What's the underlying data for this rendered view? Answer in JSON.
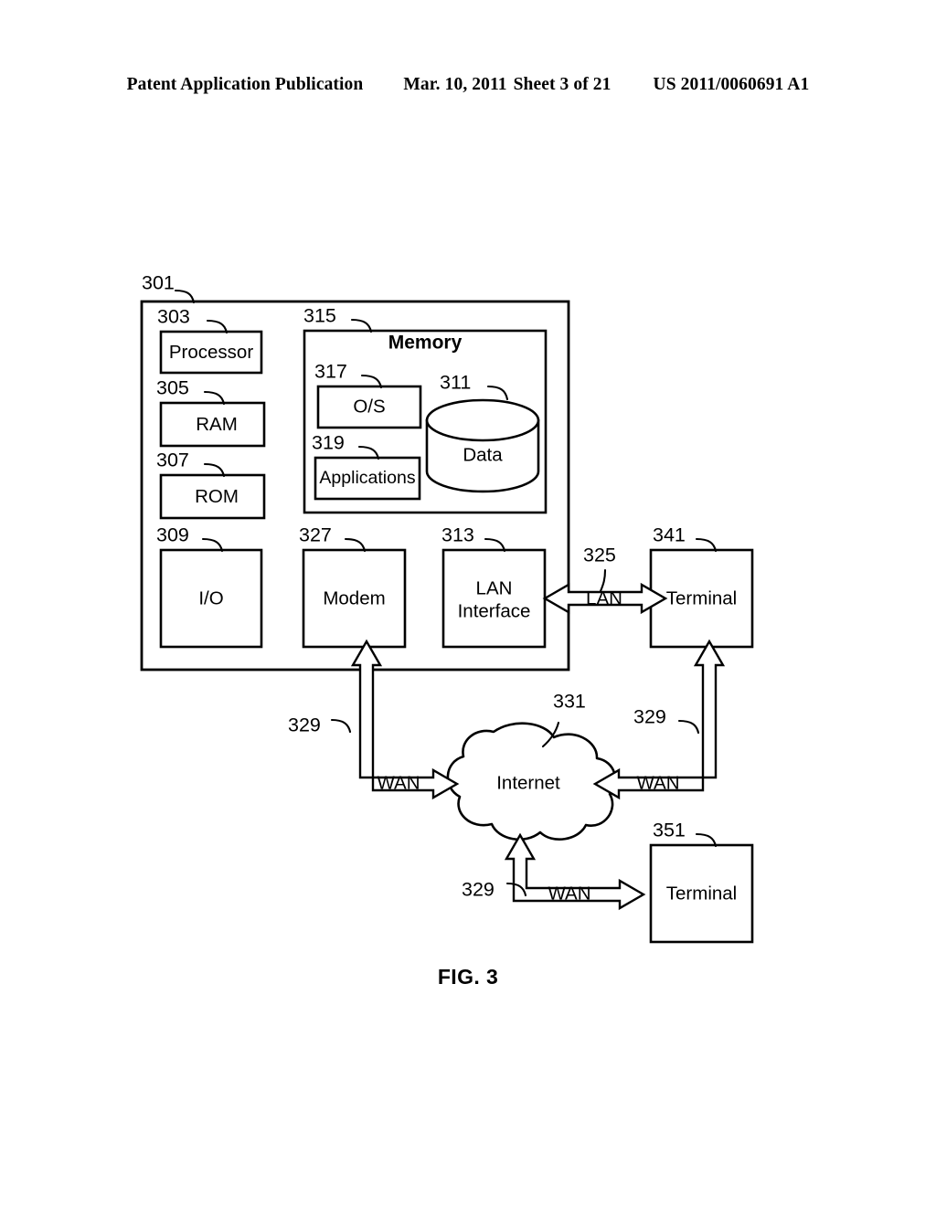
{
  "header": {
    "publication": "Patent Application Publication",
    "date": "Mar. 10, 2011",
    "sheet": "Sheet 3 of 21",
    "doc_number": "US 2011/0060691 A1"
  },
  "figure": {
    "caption": "FIG. 3",
    "ink_color": "#000000",
    "paper_color": "#ffffff"
  },
  "diagram": {
    "computer": {
      "ref": "301",
      "components": [
        {
          "ref": "303",
          "label": "Processor"
        },
        {
          "ref": "305",
          "label": "RAM"
        },
        {
          "ref": "307",
          "label": "ROM"
        },
        {
          "ref": "309",
          "label": "I/O"
        },
        {
          "ref": "327",
          "label": "Modem"
        },
        {
          "ref": "313",
          "label": "LAN\nInterface"
        }
      ],
      "lan_interface_line1": "LAN",
      "lan_interface_line2": "Interface"
    },
    "memory": {
      "ref": "315",
      "title": "Memory",
      "items": [
        {
          "ref": "317",
          "label": "O/S"
        },
        {
          "ref": "319",
          "label": "Applications"
        }
      ],
      "store": {
        "ref": "311",
        "label": "Data"
      }
    },
    "network": {
      "lan_link": {
        "ref": "325",
        "label": "LAN"
      },
      "cloud": {
        "ref": "331",
        "label": "Internet"
      },
      "wan_links": [
        {
          "ref": "329",
          "label": "WAN"
        },
        {
          "ref": "329",
          "label": "WAN"
        },
        {
          "ref": "329",
          "label": "WAN"
        }
      ]
    },
    "terminals": [
      {
        "ref": "341",
        "label": "Terminal"
      },
      {
        "ref": "351",
        "label": "Terminal"
      }
    ]
  }
}
